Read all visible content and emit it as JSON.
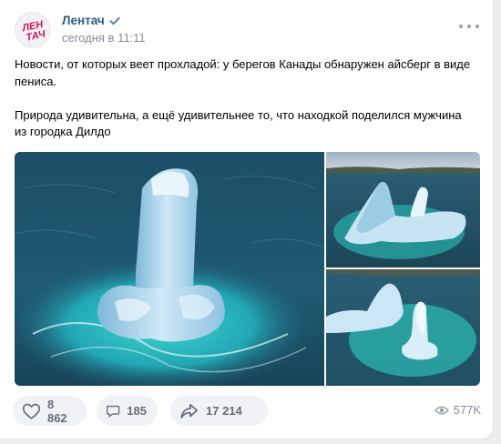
{
  "post": {
    "author": "Лентач",
    "time": "сегодня в 11:11",
    "avatar_text_line1": "ЛЕН",
    "avatar_text_line2": "ТАЧ",
    "text": [
      "Новости, от которых веет прохладой: у берегов Канады обнаружен айсберг в виде пениса.",
      "Природа удивительна, а ещё удивительнее то, что находкой поделился мужчина из городка Дилдо"
    ]
  },
  "footer": {
    "likes": "8 862",
    "comments": "185",
    "shares": "17 214",
    "views": "577K"
  },
  "colors": {
    "author_link": "#2a5885",
    "muted": "#818c99",
    "action_bg": "#f0f2f5",
    "verified": "#5181b8"
  },
  "icons": [
    "verified-icon",
    "more-icon",
    "heart-icon",
    "comment-icon",
    "share-icon",
    "eye-icon"
  ]
}
